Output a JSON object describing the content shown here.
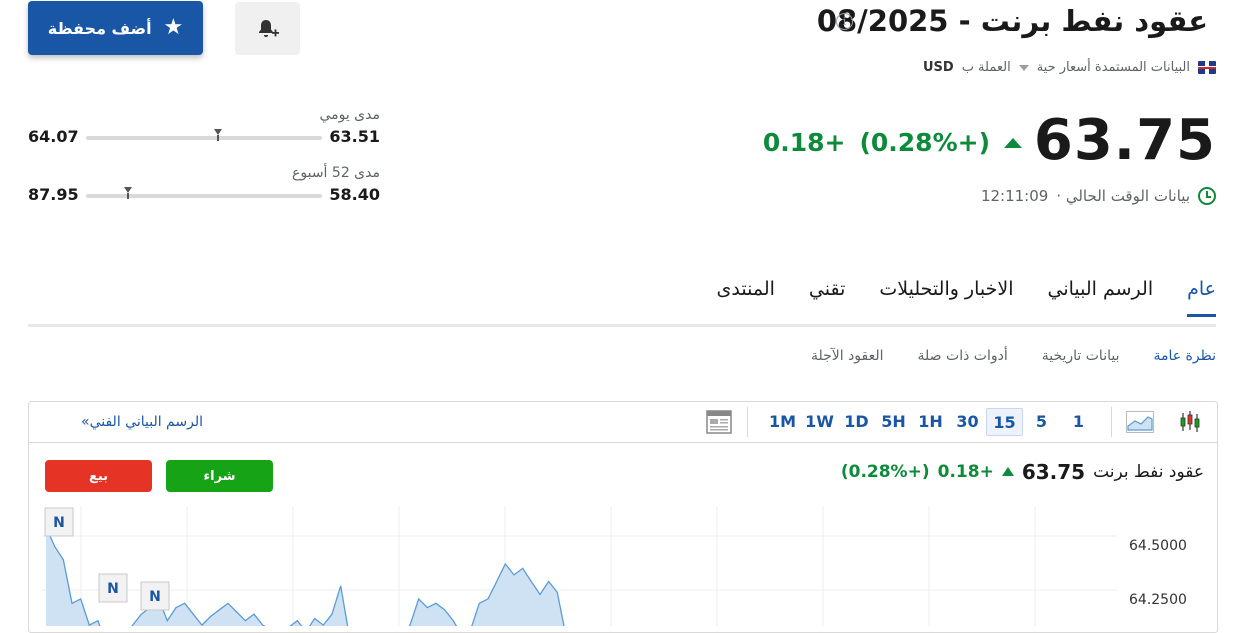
{
  "header": {
    "title": "عقود نفط برنت - 08/2025",
    "info_icon": "i",
    "data_source": "البيانات المستمدة أسعار حية",
    "currency_label": "العملة ب",
    "currency": "USD"
  },
  "actions": {
    "add_portfolio": "أضف محفظة"
  },
  "quote": {
    "price": "63.75",
    "change": "+0.18",
    "change_pct": "(+0.28%)",
    "time_label": "بيانات الوقت الحالي ·",
    "time": "12:11:09"
  },
  "ranges": {
    "daily": {
      "label": "مدى يومي",
      "low": "63.51",
      "high": "64.07",
      "position": 0.44
    },
    "week52": {
      "label": "مدى 52 أسبوع",
      "low": "58.40",
      "high": "87.95",
      "position": 0.82
    }
  },
  "tabs": [
    {
      "label": "عام",
      "active": true
    },
    {
      "label": "الرسم البياني"
    },
    {
      "label": "الاخبار والتحليلات"
    },
    {
      "label": "تقني"
    },
    {
      "label": "المنتدى"
    }
  ],
  "subtabs": [
    {
      "label": "نظرة عامة",
      "active": true
    },
    {
      "label": "بيانات تاريخية"
    },
    {
      "label": "أدوات ذات صلة"
    },
    {
      "label": "العقود الآجلة"
    }
  ],
  "chart_toolbar": {
    "technical_chart_link": "الرسم البياني الفني",
    "link_arrow": "»",
    "timeframes": [
      "1M",
      "1W",
      "1D",
      "5H",
      "1H",
      "30",
      "15",
      "5",
      "1"
    ],
    "active_timeframe": "15"
  },
  "chart_header": {
    "name": "عقود نفط برنت",
    "price": "63.75",
    "change": "+0.18",
    "change_pct": "(+0.28%)",
    "buy": "شراء",
    "sell": "بيع"
  },
  "chart_data": {
    "type": "area",
    "y_ticks": [
      "64.5000",
      "64.2500"
    ],
    "ylim": [
      64.05,
      64.6
    ],
    "series": [
      {
        "values": [
          64.55,
          64.46,
          64.4,
          64.2,
          64.22,
          64.1,
          64.12,
          64.0,
          64.05,
          64.02,
          64.1,
          64.15,
          64.18,
          64.22,
          64.12,
          64.18,
          64.2,
          64.15,
          64.1,
          64.14,
          64.17,
          64.2,
          64.16,
          64.12,
          64.15,
          64.1,
          64.08,
          64.04,
          64.09,
          64.12,
          64.07,
          64.13,
          64.1,
          64.15,
          64.28,
          64.05,
          64.03,
          64.02,
          64.06,
          64.08,
          64.05,
          64.04,
          64.1,
          64.22,
          64.18,
          64.2,
          64.17,
          64.12,
          64.05,
          64.08,
          64.2,
          64.22,
          64.3,
          64.38,
          64.33,
          64.36,
          64.3,
          64.24,
          64.3,
          64.25,
          64.05
        ]
      }
    ],
    "markers": [
      "N",
      "N",
      "N"
    ],
    "colors": {
      "line": "#5b9bd5",
      "fill": "#cfe2f3"
    }
  },
  "colors": {
    "accent": "#1a56a6",
    "up": "#0d8a3a",
    "buy": "#16a316",
    "sell": "#e53426"
  }
}
